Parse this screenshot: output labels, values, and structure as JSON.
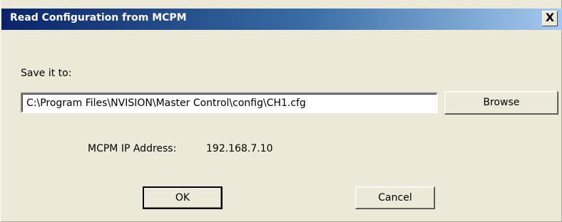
{
  "window": {
    "title": "Read Configuration from MCPM",
    "close_label": "X"
  },
  "form": {
    "save_label": "Save it to:",
    "save_path": "C:\\Program Files\\NVISION\\Master Control\\config\\CH1.cfg",
    "browse_label": "Browse",
    "ip_label": "MCPM IP Address:",
    "ip_value": "192.168.7.10"
  },
  "buttons": {
    "ok_label": "OK",
    "cancel_label": "Cancel"
  },
  "colors": {
    "titlebar_start": "#0a246a",
    "titlebar_end": "#a6caf0",
    "dialog_face": "#ece9d8"
  }
}
